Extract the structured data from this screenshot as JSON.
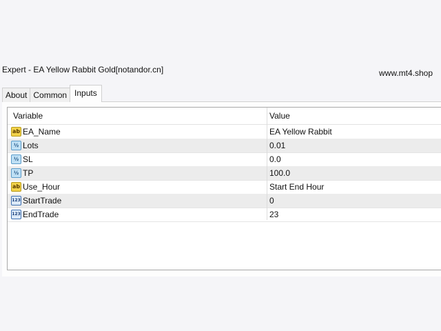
{
  "window": {
    "title": "Expert - EA Yellow Rabbit Gold[notandor.cn]",
    "watermark": "www.mt4.shop"
  },
  "tabs": [
    {
      "label": "About",
      "active": false
    },
    {
      "label": "Common",
      "active": false
    },
    {
      "label": "Inputs",
      "active": true
    }
  ],
  "table": {
    "headers": {
      "variable": "Variable",
      "value": "Value"
    },
    "rows": [
      {
        "icon": "string-type-icon",
        "badge": "ab",
        "variable": "EA_Name",
        "value": "EA Yellow Rabbit"
      },
      {
        "icon": "double-type-icon",
        "badge": "½",
        "variable": "Lots",
        "value": "0.01"
      },
      {
        "icon": "double-type-icon",
        "badge": "½",
        "variable": "SL",
        "value": "0.0"
      },
      {
        "icon": "double-type-icon",
        "badge": "½",
        "variable": "TP",
        "value": "100.0"
      },
      {
        "icon": "string-type-icon",
        "badge": "ab",
        "variable": "Use_Hour",
        "value": "Start End Hour"
      },
      {
        "icon": "integer-type-icon",
        "badge": "123",
        "variable": "StartTrade",
        "value": "0"
      },
      {
        "icon": "integer-type-icon",
        "badge": "123",
        "variable": "EndTrade",
        "value": "23"
      }
    ]
  }
}
